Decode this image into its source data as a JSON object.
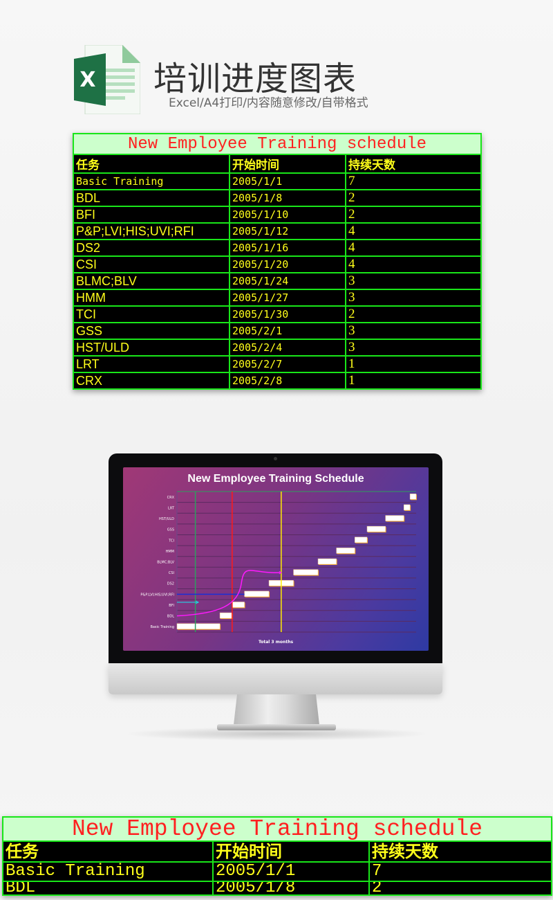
{
  "header": {
    "title": "培训进度图表",
    "subtitle": "Excel/A4打印/内容随意修改/自带格式",
    "icon": "excel-file-icon",
    "icon_letter": "X"
  },
  "colors": {
    "grid_border": "#19e619",
    "title_bg": "#ccffcc",
    "title_text": "#ff2020",
    "cell_text": "#ffff1a",
    "cell_bg": "#000000"
  },
  "table": {
    "title": "New Employee Training schedule",
    "columns": [
      "任务",
      "开始时间",
      "持续天数"
    ],
    "rows": [
      [
        "Basic Training",
        "2005/1/1",
        "7"
      ],
      [
        "BDL",
        "2005/1/8",
        "2"
      ],
      [
        "BFI",
        "2005/1/10",
        "2"
      ],
      [
        "P&P;LVI;HIS;UVI;RFI",
        "2005/1/12",
        "4"
      ],
      [
        "DS2",
        "2005/1/16",
        "4"
      ],
      [
        "CSI",
        "2005/1/20",
        "4"
      ],
      [
        "BLMC;BLV",
        "2005/1/24",
        "3"
      ],
      [
        "HMM",
        "2005/1/27",
        "3"
      ],
      [
        "TCI",
        "2005/1/30",
        "2"
      ],
      [
        "GSS",
        "2005/2/1",
        "3"
      ],
      [
        "HST/ULD",
        "2005/2/4",
        "3"
      ],
      [
        "LRT",
        "2005/2/7",
        "1"
      ],
      [
        "CRX",
        "2005/2/8",
        "1"
      ]
    ]
  },
  "chart_data": {
    "type": "bar",
    "orientation": "horizontal-gantt",
    "title": "New Employee Training Schedule",
    "xlabel": "Total 3 months",
    "categories": [
      "Basic Training",
      "BDL",
      "BFI",
      "P&P;LVI;HIS;UVI;RFI",
      "DS2",
      "CSI",
      "BLMC;BLV",
      "HMM",
      "TCI",
      "GSS",
      "HST/ULD",
      "LRT",
      "CRX"
    ],
    "start": [
      "2005/1/1",
      "2005/1/8",
      "2005/1/10",
      "2005/1/12",
      "2005/1/16",
      "2005/1/20",
      "2005/1/24",
      "2005/1/27",
      "2005/1/30",
      "2005/2/1",
      "2005/2/4",
      "2005/2/7",
      "2005/2/8"
    ],
    "duration_days": [
      7,
      2,
      2,
      4,
      4,
      4,
      3,
      3,
      2,
      3,
      3,
      1,
      1
    ],
    "xlim": [
      "2005/1/1",
      "2005/2/9"
    ],
    "grid": "horizontal",
    "bar_color": "#ffffff",
    "bar_edge_color": "#f5a623",
    "background": [
      "#a03876",
      "#2e3aa3"
    ],
    "reference_lines": [
      {
        "date": "2005/1/4",
        "color": "#2e9e5e"
      },
      {
        "date": "2005/1/10",
        "color": "#ff1a1a"
      },
      {
        "date": "2005/1/18",
        "color": "#ffee00"
      }
    ],
    "annotation_colors": {
      "curve": "#ff1aff",
      "arrow_bfi": "#22d3e6",
      "line_pp": "#1a2fd6"
    }
  }
}
